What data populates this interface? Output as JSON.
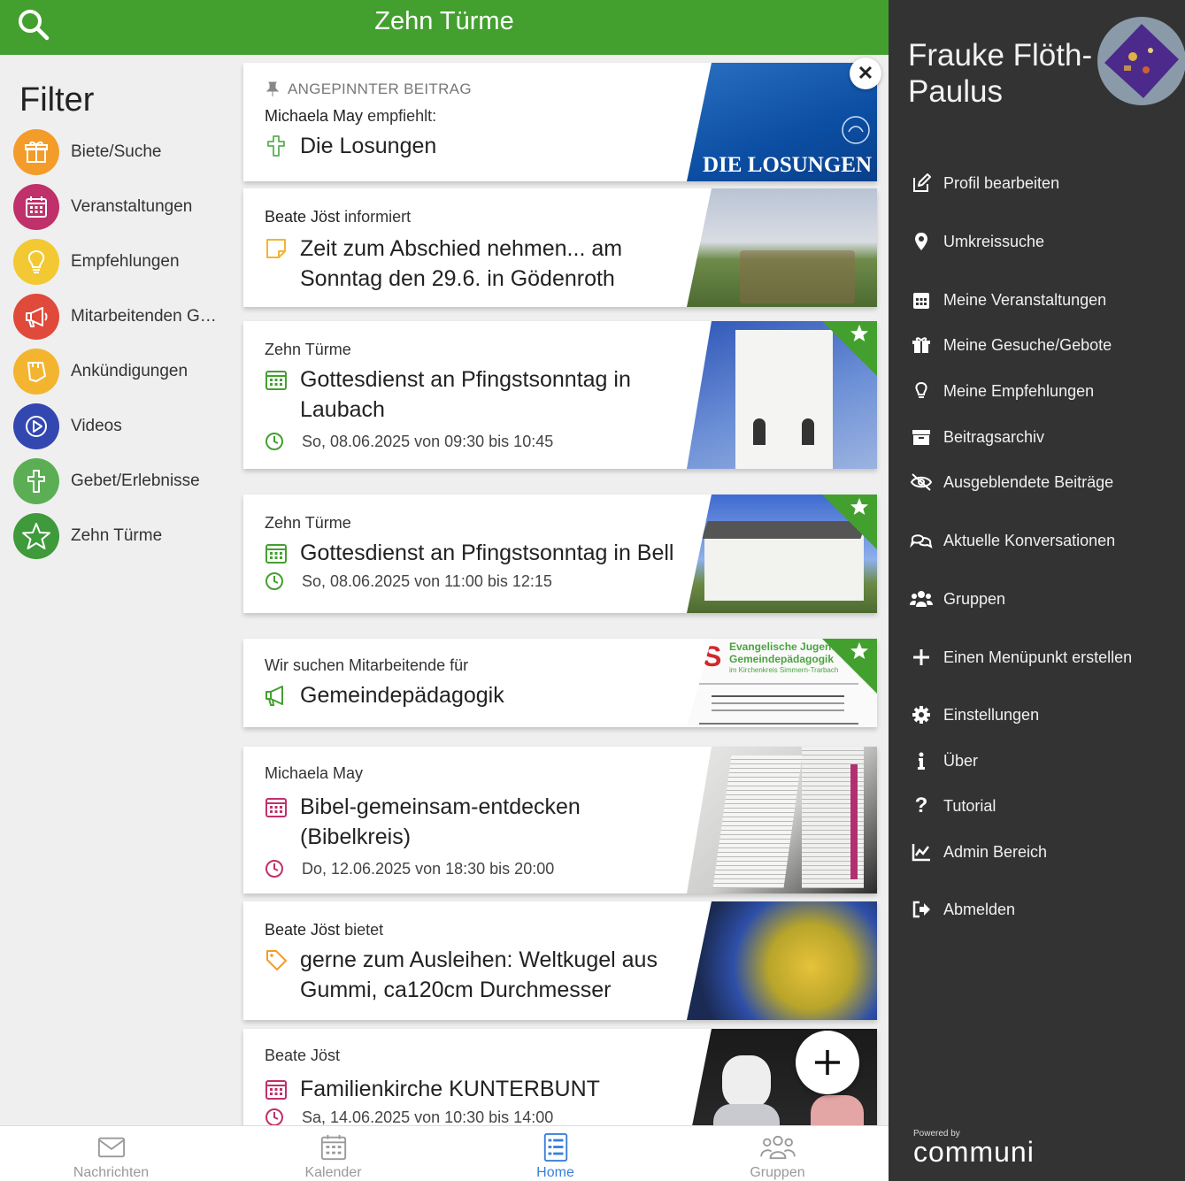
{
  "header": {
    "title": "Zehn Türme",
    "search_icon": "search-icon"
  },
  "filter": {
    "title": "Filter",
    "items": [
      {
        "label": "Biete/Suche",
        "icon": "gift-icon",
        "color": "#f39c2a"
      },
      {
        "label": "Veranstaltungen",
        "icon": "calendar-icon",
        "color": "#c0306a"
      },
      {
        "label": "Empfehlungen",
        "icon": "lightbulb-icon",
        "color": "#f2c933"
      },
      {
        "label": "Mitarbeitenden Ges...",
        "icon": "megaphone-icon",
        "color": "#e04a3a"
      },
      {
        "label": "Ankündigungen",
        "icon": "note-icon",
        "color": "#f3b530"
      },
      {
        "label": "Videos",
        "icon": "play-icon",
        "color": "#3347b0"
      },
      {
        "label": "Gebet/Erlebnisse",
        "icon": "cross-icon",
        "color": "#5cae55"
      },
      {
        "label": "Zehn Türme",
        "icon": "star-icon",
        "color": "#3e9a3a"
      }
    ]
  },
  "cards": [
    {
      "pinned_label": "ANGEPINNTER BEITRAG",
      "author": "Michaela May",
      "verb": "empfiehlt:",
      "title": "Die Losungen",
      "image_text": "DIE LOSUNGEN"
    },
    {
      "author": "Beate Jöst",
      "verb": "informiert",
      "title": "Zeit zum Abschied nehmen... am Sonntag den 29.6. in Gödenroth"
    },
    {
      "author": "Zehn Türme",
      "title": "Gottesdienst an Pfingstsonntag in Laubach",
      "date": "So, 08.06.2025 von 09:30 bis 10:45"
    },
    {
      "author": "Zehn Türme",
      "title": "Gottesdienst an Pfingstsonntag in Bell",
      "date": "So, 08.06.2025 von 11:00 bis 12:15"
    },
    {
      "author": "Wir suchen Mitarbeitende für",
      "title": "Gemeindepädagogik",
      "image_line1": "Evangelische Jugend",
      "image_line2": "Gemeindepädagogik",
      "image_line3": "im Kirchenkreis Simmern-Trarbach"
    },
    {
      "author": "Michaela May",
      "title": "Bibel-gemeinsam-entdecken (Bibelkreis)",
      "date": "Do, 12.06.2025 von 18:30 bis 20:00"
    },
    {
      "author": "Beate Jöst",
      "verb": "bietet",
      "title": "gerne zum Ausleihen: Weltkugel aus Gummi, ca120cm Durchmesser"
    },
    {
      "author": "Beate Jöst",
      "title": "Familienkirche KUNTERBUNT",
      "date": "Sa, 14.06.2025 von 10:30 bis 14:00"
    }
  ],
  "bottom_nav": [
    {
      "label": "Nachrichten",
      "icon": "envelope-icon"
    },
    {
      "label": "Kalender",
      "icon": "calendar-icon"
    },
    {
      "label": "Home",
      "icon": "list-icon",
      "active": true
    },
    {
      "label": "Gruppen",
      "icon": "people-icon"
    }
  ],
  "side": {
    "user_name": "Frauke Flöth-Paulus",
    "menu": [
      {
        "label": "Profil bearbeiten",
        "icon": "edit-icon"
      },
      {
        "label": "Umkreissuche",
        "icon": "map-pin-icon"
      },
      {
        "label": "Meine Veranstaltungen",
        "icon": "calendar-icon"
      },
      {
        "label": "Meine Gesuche/Gebote",
        "icon": "gift-icon"
      },
      {
        "label": "Meine Empfehlungen",
        "icon": "lightbulb-icon"
      },
      {
        "label": "Beitragsarchiv",
        "icon": "archive-icon"
      },
      {
        "label": "Ausgeblendete Beiträge",
        "icon": "eye-slash-icon"
      },
      {
        "label": "Aktuelle Konversationen",
        "icon": "chat-icon"
      },
      {
        "label": "Gruppen",
        "icon": "users-icon"
      },
      {
        "label": "Einen Menüpunkt erstellen",
        "icon": "plus-icon"
      },
      {
        "label": "Einstellungen",
        "icon": "gear-icon"
      },
      {
        "label": "Über",
        "icon": "info-icon"
      },
      {
        "label": "Tutorial",
        "icon": "question-icon"
      },
      {
        "label": "Admin Bereich",
        "icon": "chart-icon"
      },
      {
        "label": "Abmelden",
        "icon": "logout-icon"
      }
    ],
    "powered_by": "Powered by",
    "brand": "communi"
  },
  "colors": {
    "brand_green": "#43a02f",
    "panel_dark": "#333333",
    "active_blue": "#3a7fd9"
  }
}
